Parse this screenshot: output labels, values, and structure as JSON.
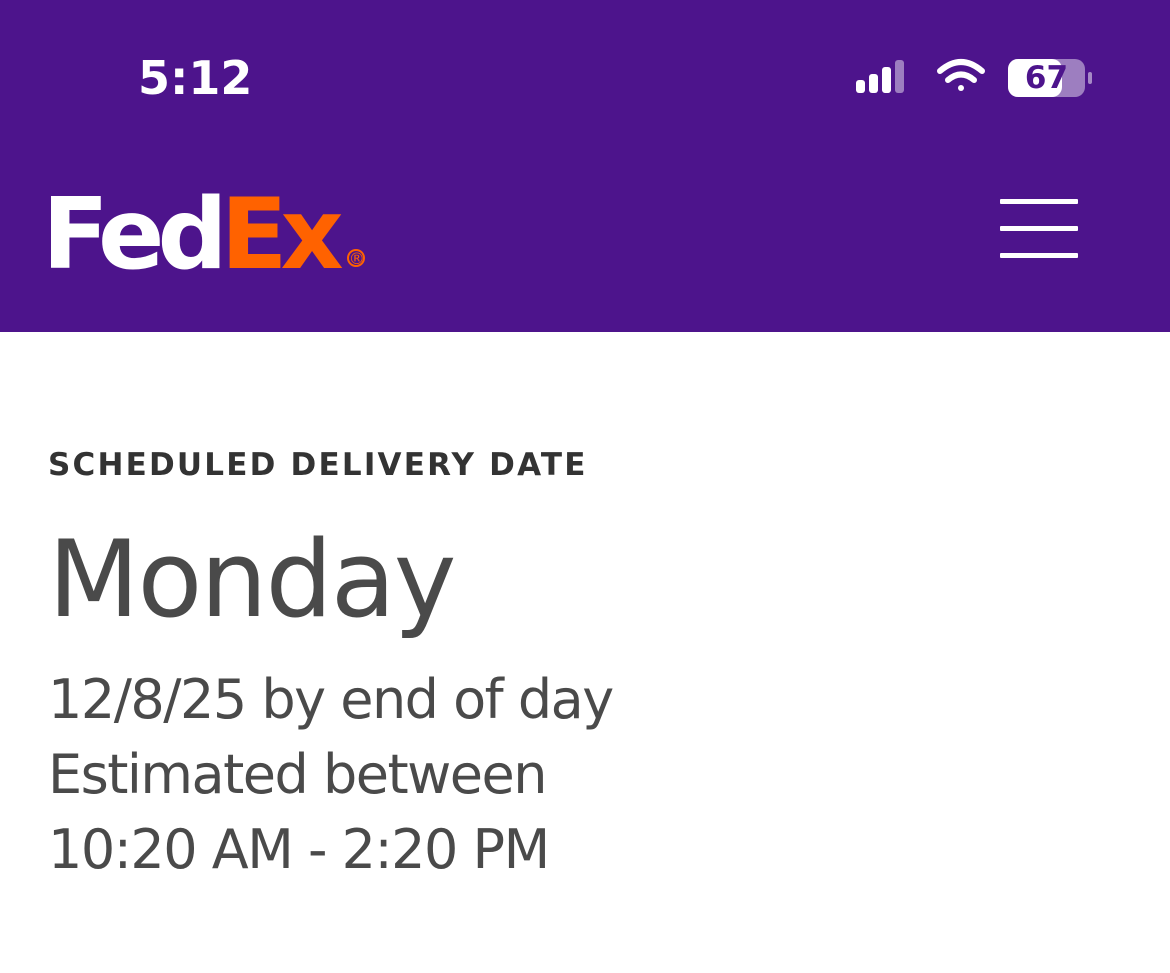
{
  "status_bar": {
    "time": "5:12",
    "battery_level": "67",
    "signal_icon": "cellular-signal-icon",
    "wifi_icon": "wifi-icon",
    "battery_icon": "battery-icon"
  },
  "header": {
    "logo": {
      "part1": "Fed",
      "part2": "Ex",
      "registered": "®"
    },
    "menu_icon": "hamburger-menu-icon",
    "colors": {
      "background": "#4d148c",
      "brand_orange": "#ff6200",
      "brand_white": "#ffffff"
    }
  },
  "delivery": {
    "label": "SCHEDULED DELIVERY DATE",
    "day": "Monday",
    "date_line": "12/8/25 by end of day",
    "estimate_line": "Estimated between",
    "time_window": "10:20 AM - 2:20 PM"
  }
}
